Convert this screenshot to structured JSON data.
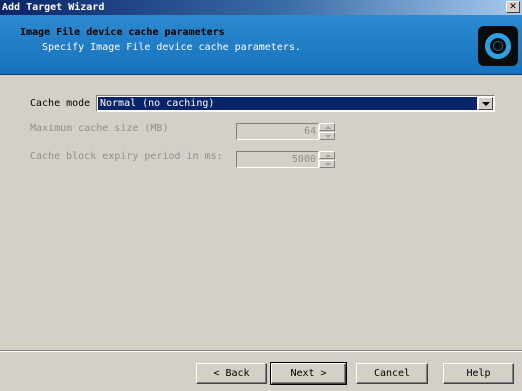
{
  "window": {
    "title": "Add Target Wizard",
    "close_glyph": "✕"
  },
  "header": {
    "title": "Image File device cache parameters",
    "subtitle": "Specify Image File device cache parameters.",
    "logo_icon": "target-ring-icon"
  },
  "form": {
    "cache_mode": {
      "label": "Cache mode",
      "value": "Normal (no caching)"
    },
    "max_cache_size": {
      "label": "Maximum cache size (MB)",
      "value": "64"
    },
    "block_expiry": {
      "label": "Cache block expiry period in ms:",
      "value": "5000"
    }
  },
  "buttons": {
    "back": "< Back",
    "next": "Next >",
    "cancel": "Cancel",
    "help": "Help"
  },
  "colors": {
    "header_blue": "#1672bd",
    "selection": "#0a246a",
    "logo_ring": "#2aa3e3"
  }
}
